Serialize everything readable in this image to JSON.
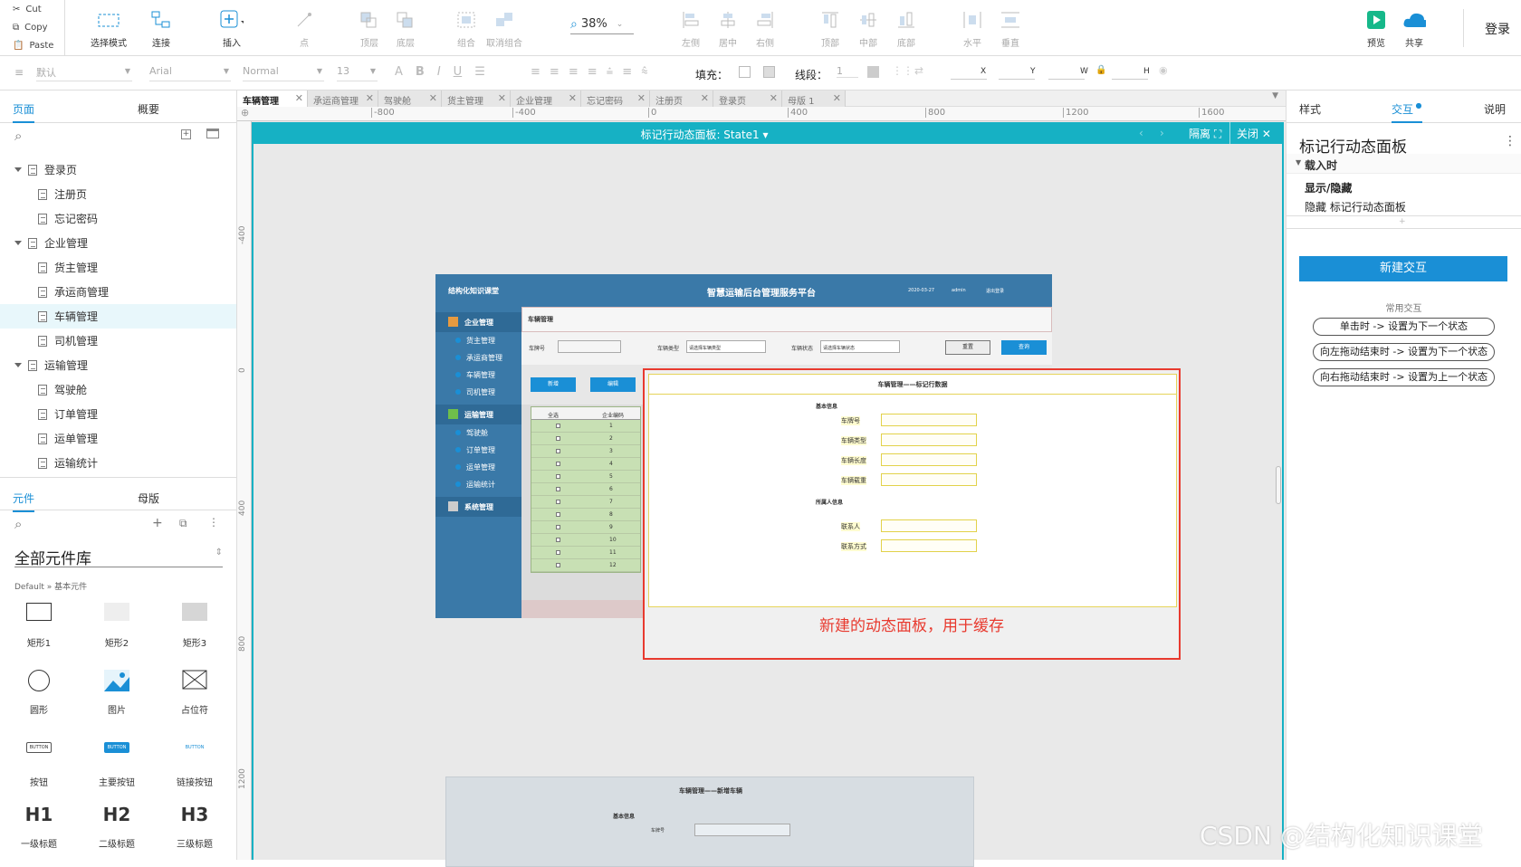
{
  "toolbar": {
    "cut": "Cut",
    "copy": "Copy",
    "paste": "Paste",
    "buttons": [
      {
        "label": "选择模式",
        "icon": "select-mode-icon"
      },
      {
        "label": "连接",
        "icon": "connect-icon"
      },
      {
        "label": "插入",
        "icon": "insert-icon"
      },
      {
        "label": "点",
        "icon": "point-icon"
      },
      {
        "label": "顶层",
        "icon": "bring-front-icon"
      },
      {
        "label": "底层",
        "icon": "send-back-icon"
      },
      {
        "label": "组合",
        "icon": "group-icon"
      },
      {
        "label": "取消组合",
        "icon": "ungroup-icon"
      },
      {
        "label": "38%",
        "icon": "zoom-icon"
      },
      {
        "label": "左侧",
        "icon": "align-left-icon"
      },
      {
        "label": "居中",
        "icon": "align-center-icon"
      },
      {
        "label": "右侧",
        "icon": "align-right-icon"
      },
      {
        "label": "顶部",
        "icon": "align-top-icon"
      },
      {
        "label": "中部",
        "icon": "align-middle-icon"
      },
      {
        "label": "底部",
        "icon": "align-bottom-icon"
      },
      {
        "label": "水平",
        "icon": "distribute-h-icon"
      },
      {
        "label": "垂直",
        "icon": "distribute-v-icon"
      },
      {
        "label": "预览",
        "icon": "preview-icon"
      },
      {
        "label": "共享",
        "icon": "share-icon"
      }
    ],
    "login": "登录"
  },
  "format": {
    "style": "默认",
    "font": "Arial",
    "weight": "Normal",
    "size": "13",
    "fill_label": "填充：",
    "line_label": "线段：",
    "line_value": "1",
    "x": "X",
    "y": "Y",
    "w": "W",
    "h": "H"
  },
  "left": {
    "tabs": [
      "页面",
      "概要"
    ],
    "pages": [
      {
        "label": "登录页",
        "level": 0,
        "expanded": true
      },
      {
        "label": "注册页",
        "level": 1
      },
      {
        "label": "忘记密码",
        "level": 1
      },
      {
        "label": "企业管理",
        "level": 0,
        "expanded": true
      },
      {
        "label": "货主管理",
        "level": 1
      },
      {
        "label": "承运商管理",
        "level": 1
      },
      {
        "label": "车辆管理",
        "level": 1,
        "selected": true
      },
      {
        "label": "司机管理",
        "level": 1
      },
      {
        "label": "运输管理",
        "level": 0,
        "expanded": true
      },
      {
        "label": "驾驶舱",
        "level": 1
      },
      {
        "label": "订单管理",
        "level": 1
      },
      {
        "label": "运单管理",
        "level": 1
      },
      {
        "label": "运输统计",
        "level": 1
      }
    ],
    "lib_tabs": [
      "元件",
      "母版"
    ],
    "library_title": "全部元件库",
    "library_path": "Default » 基本元件",
    "widgets": [
      "矩形1",
      "矩形2",
      "矩形3",
      "圆形",
      "图片",
      "占位符",
      "按钮",
      "主要按钮",
      "链接按钮",
      "一级标题",
      "二级标题",
      "三级标题"
    ],
    "widget_glyphs": {
      "button": "BUTTON",
      "h1": "H1",
      "h2": "H2",
      "h3": "H3"
    }
  },
  "doc_tabs": [
    "车辆管理",
    "承运商管理",
    "驾驶舱",
    "货主管理",
    "企业管理",
    "忘记密码",
    "注册页",
    "登录页",
    "母版 1"
  ],
  "ruler": [
    "-800",
    "-400",
    "0",
    "400",
    "800",
    "1200",
    "1600"
  ],
  "ruler_v": [
    "-400",
    "0",
    "400",
    "800",
    "1200"
  ],
  "dynamic_panel": {
    "title": "标记行动态面板: State1 ▾",
    "isolate": "隔离",
    "close": "关闭"
  },
  "mock": {
    "brand": "结构化知识课堂",
    "title": "智慧运输后台管理服务平台",
    "date": "2020-03-27",
    "user": "admin",
    "logout": "退出登录",
    "menu": [
      {
        "label": "企业管理",
        "group": true
      },
      {
        "label": "货主管理"
      },
      {
        "label": "承运商管理"
      },
      {
        "label": "车辆管理"
      },
      {
        "label": "司机管理"
      },
      {
        "label": "运输管理",
        "group": true
      },
      {
        "label": "驾驶舱"
      },
      {
        "label": "订单管理"
      },
      {
        "label": "运单管理"
      },
      {
        "label": "运输统计"
      },
      {
        "label": "系统管理",
        "group": true
      }
    ],
    "page_title": "车辆管理",
    "filters": [
      "车牌号",
      "车辆类型",
      "请选择车辆类型",
      "车辆状态",
      "请选择车辆状态"
    ],
    "reset": "重置",
    "query": "查询",
    "add": "新增",
    "edit": "编辑",
    "grid_headers": [
      "全选",
      "企业编码"
    ],
    "grid_rows": [
      "1",
      "2",
      "3",
      "4",
      "5",
      "6",
      "7",
      "8",
      "9",
      "10",
      "11",
      "12"
    ]
  },
  "popup": {
    "title": "车辆管理——标记行数据",
    "section1": "基本信息",
    "fields1": [
      "车牌号",
      "车辆类型",
      "车辆长度",
      "车辆载重"
    ],
    "section2": "所属人信息",
    "fields2": [
      "联系人",
      "联系方式"
    ],
    "annotation": "新建的动态面板，用于缓存"
  },
  "lower_form": {
    "title": "车辆管理——新增车辆",
    "section": "基本信息",
    "field": "车牌号"
  },
  "right": {
    "tabs": [
      "样式",
      "交互",
      "说明"
    ],
    "panel_title": "标记行动态面板",
    "event": "载入时",
    "action": "显示/隐藏",
    "action_detail": "隐藏 标记行动态面板",
    "new_btn": "新建交互",
    "common_title": "常用交互",
    "common": [
      "单击时 -> 设置为下一个状态",
      "向左拖动结束时 -> 设置为下一个状态",
      "向右拖动结束时 -> 设置为上一个状态"
    ]
  },
  "watermark": "CSDN @结构化知识课堂",
  "colors": {
    "accent": "#16b1c4",
    "primary": "#1a8fd6",
    "mock_sidebar": "#3a79a8",
    "highlight": "#e83a2f"
  }
}
